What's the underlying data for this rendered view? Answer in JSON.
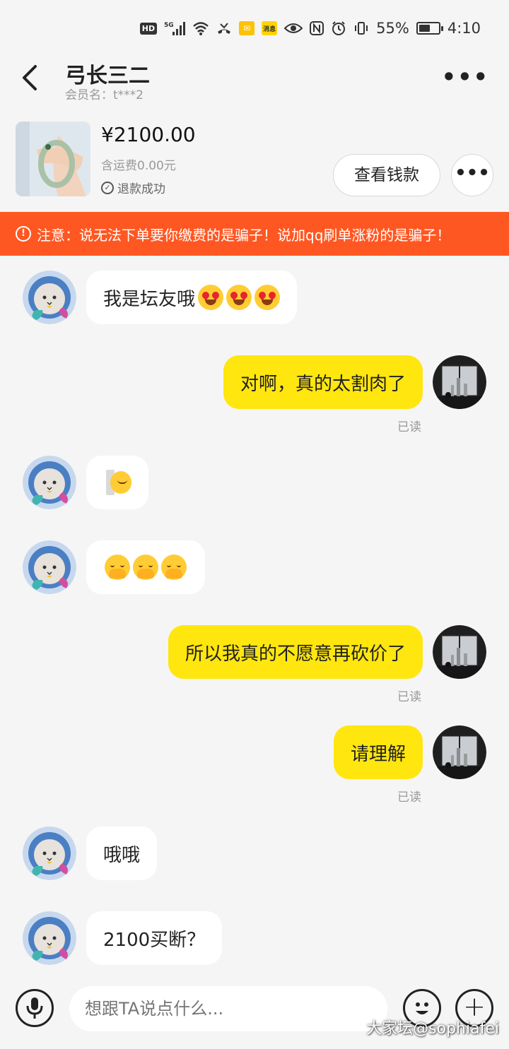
{
  "status_bar": {
    "hd": "HD",
    "signal": "5G",
    "yellow_icon": "消息",
    "battery": "55%",
    "battery_level": 0.55,
    "time": "4:10"
  },
  "header": {
    "title": "弓长三二",
    "member": "会员名：t***2",
    "more": "•••"
  },
  "product": {
    "price": "¥2100.00",
    "shipping": "含运费0.00元",
    "status": "退款成功",
    "view_button": "查看钱款",
    "more_button": "•••"
  },
  "warning": {
    "text": "注意：说无法下单要你缴费的是骗子！说加qq刷单涨粉的是骗子！"
  },
  "messages": [
    {
      "side": "in",
      "text": "我是坛友哦",
      "emoji": "heart-eyes-face x3"
    },
    {
      "side": "out",
      "text": "对啊，真的太割肉了",
      "read": "已读"
    },
    {
      "side": "in",
      "text": "",
      "emoji": "peeking-face"
    },
    {
      "side": "in",
      "text": "",
      "emoji": "hand-over-mouth-face x3"
    },
    {
      "side": "out",
      "text": "所以我真的不愿意再砍价了",
      "read": "已读"
    },
    {
      "side": "out",
      "text": "请理解",
      "read": "已读"
    },
    {
      "side": "in",
      "text": "哦哦"
    },
    {
      "side": "in",
      "text": "2100买断？"
    }
  ],
  "input": {
    "placeholder": "想跟TA说点什么..."
  },
  "watermark": "大家坛@sophiafei",
  "colors": {
    "warning_bg": "#ff5722",
    "outgoing_bubble": "#ffe60f",
    "incoming_bubble": "#ffffff",
    "background": "#f5f5f5"
  },
  "icons": [
    "back-chevron-icon",
    "more-icon",
    "check-circle-icon",
    "alert-icon",
    "mic-icon",
    "emoji-icon",
    "plus-icon"
  ]
}
